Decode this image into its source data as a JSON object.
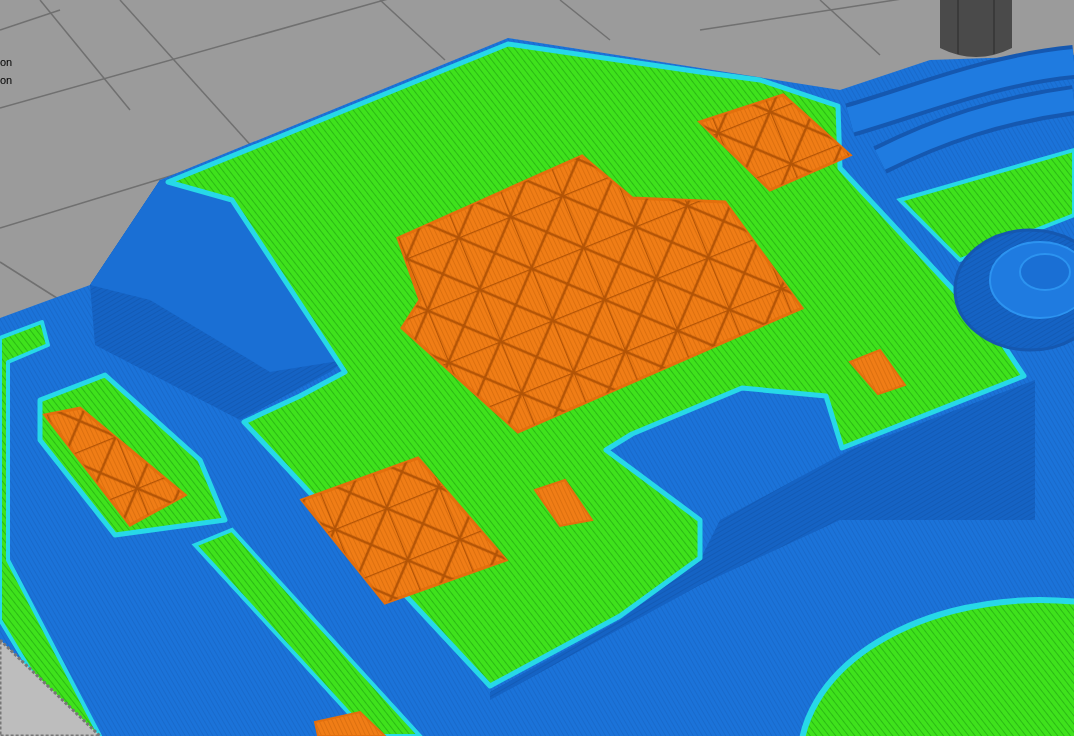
{
  "viewport": {
    "legend": [
      {
        "label": "on"
      },
      {
        "label": "on"
      }
    ]
  }
}
